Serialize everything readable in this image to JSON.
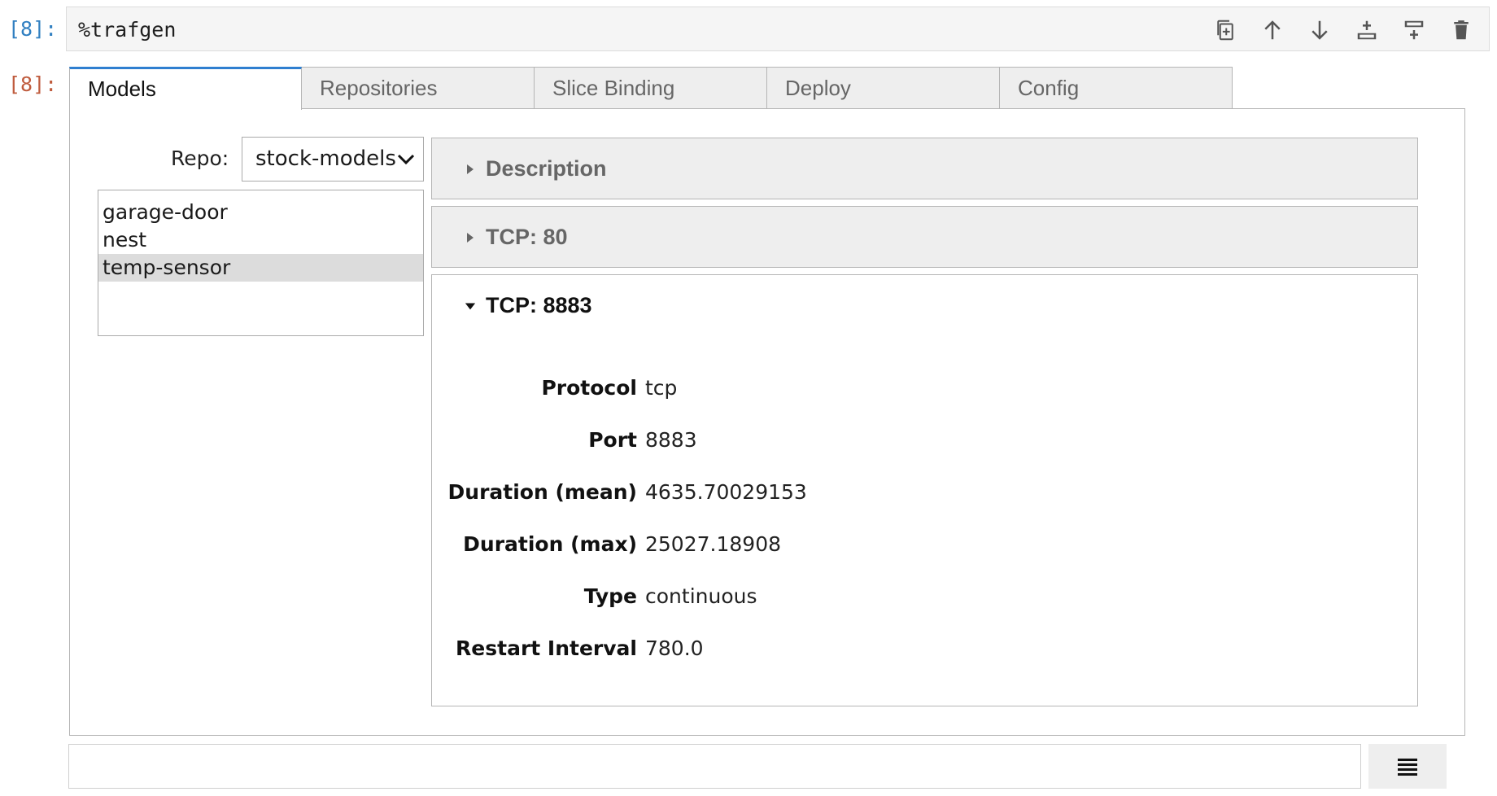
{
  "cell": {
    "in_prompt": "[8]:",
    "out_prompt": "[8]:",
    "code": "%trafgen",
    "toolbar": [
      "duplicate-icon",
      "move-up-icon",
      "move-down-icon",
      "insert-below-icon",
      "insert-above-icon",
      "delete-icon"
    ]
  },
  "tabs": [
    {
      "label": "Models",
      "active": true
    },
    {
      "label": "Repositories",
      "active": false
    },
    {
      "label": "Slice Binding",
      "active": false
    },
    {
      "label": "Deploy",
      "active": false
    },
    {
      "label": "Config",
      "active": false
    }
  ],
  "repo": {
    "label": "Repo:",
    "selected": "stock-models"
  },
  "models": [
    {
      "name": "garage-door",
      "selected": false
    },
    {
      "name": "nest",
      "selected": false
    },
    {
      "name": "temp-sensor",
      "selected": true
    }
  ],
  "sections": {
    "description": {
      "title": "Description",
      "expanded": false
    },
    "tcp80": {
      "title": "TCP: 80",
      "expanded": false
    },
    "tcp8883": {
      "title": "TCP: 8883",
      "expanded": true,
      "properties": [
        {
          "key": "Protocol",
          "value": "tcp"
        },
        {
          "key": "Port",
          "value": "8883"
        },
        {
          "key": "Duration (mean)",
          "value": "4635.70029153"
        },
        {
          "key": "Duration (max)",
          "value": "25027.18908"
        },
        {
          "key": "Type",
          "value": "continuous"
        },
        {
          "key": "Restart Interval",
          "value": "780.0"
        }
      ]
    }
  },
  "output_area": {
    "input_value": "",
    "menu_icon": "hamburger-menu-icon"
  }
}
